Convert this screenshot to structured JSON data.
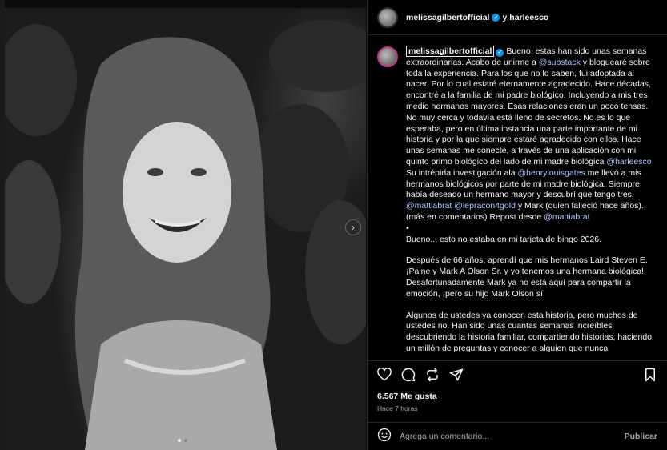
{
  "post": {
    "header": {
      "author": "melissagilbertofficial",
      "separator": "y",
      "collaborator": "harleesco"
    },
    "caption": {
      "owner": "melissagilbertofficial",
      "p1_a": "Bueno, estas han sido unas semanas extraordinarias. Acabo de unirme a ",
      "p1_mention1": "@substack",
      "p1_b": " y bloguearé sobre toda la experiencia. Para los que no lo saben, fui adoptada al nacer. Por lo cual estaré eternamente agradecido. Hace décadas, encontré a la familia de mi padre biológico. Incluyendo a mis tres medio hermanos mayores. Esas relaciones eran un poco tensas. No muy cerca y todavía está lleno de secretos. No es lo que esperaba, pero en última instancia una parte importante de mi historia y por la que siempre estaré agradecido con ellos. Hace unas semanas me conecté, a través de una aplicación con mi quinto primo biológico del lado de mi madre biológica ",
      "p1_mention2": "@harleesco",
      "p1_c": " Su intrépida investigación ala ",
      "p1_mention3": "@henrylouisgates",
      "p1_d": " me llevó a mis hermanos biológicos por parte de mi madre biológica. Siempre había deseado un hermano mayor y descubrí que tengo tres. ",
      "p1_mention4": "@mattlabrat",
      "p1_mention5": "@lepracon4gold",
      "p1_e": " y Mark (quien falleció hace años). (más en comentarios) Repost desde ",
      "p1_mention6": "@mattiabrat",
      "bullet": "•",
      "p2": "Bueno... esto no estaba en mi tarjeta de bingo 2026.",
      "p3": "Después de 66 años, aprendí que mis hermanos Laird Steven E. ¡Paine y Mark A Olson Sr. y yo tenemos una hermana biológica! Desafortunadamente Mark ya no está aquí para compartir la emoción, ¡pero su hijo Mark Olson sí!",
      "p4": "Algunos de ustedes ya conocen esta historia, pero muchos de ustedes no. Han sido unas cuantas semanas increíbles descubriendo la historia familiar, compartiendo historias, haciendo un millón de preguntas y conocer a alguien que nunca"
    },
    "likes": "6.567 Me gusta",
    "time": "Hace 7 horas",
    "comment": {
      "placeholder": "Agrega un comentario...",
      "publish": "Publicar"
    }
  },
  "icons": {
    "like": "heart-icon",
    "comment": "comment-icon",
    "repost": "repost-icon",
    "share": "send-icon",
    "save": "bookmark-icon",
    "emoji": "emoji-icon",
    "next": "chevron-right-icon"
  },
  "colors": {
    "background": "#000000",
    "mention": "#b8c7ff",
    "verified": "#0095f6",
    "muted": "#a8a8a8"
  }
}
